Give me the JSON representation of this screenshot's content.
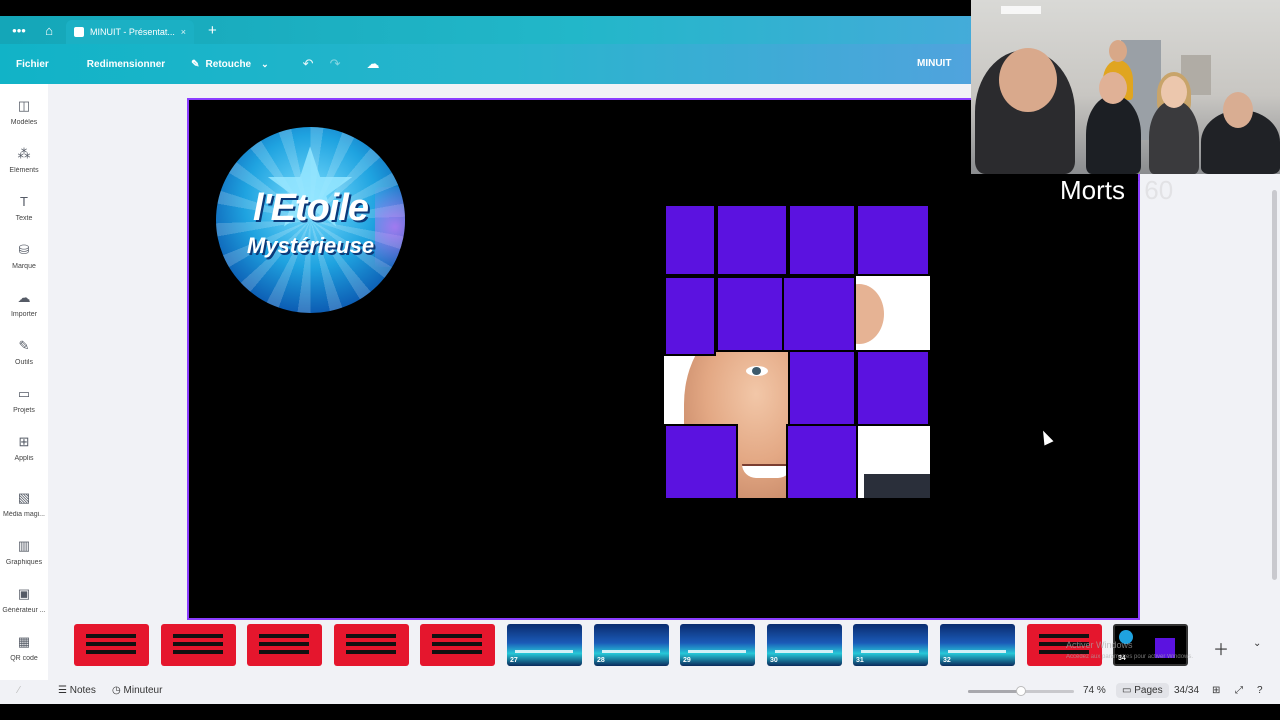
{
  "browser": {
    "tab_title": "MINUIT - Présentat...",
    "tab_close": "×",
    "new_tab": "+",
    "menu_glyph": "•••",
    "home_glyph": "⌂"
  },
  "toolbar": {
    "file_label": "Fichier",
    "resize_label": "Redimensionner",
    "retouch_label": "Retouche",
    "doc_name": "MINUIT"
  },
  "sidebar": {
    "items": [
      {
        "label": "Modèles"
      },
      {
        "label": "Éléments"
      },
      {
        "label": "Texte"
      },
      {
        "label": "Marque"
      },
      {
        "label": "Importer"
      },
      {
        "label": "Outils"
      },
      {
        "label": "Projets"
      },
      {
        "label": "Applis"
      },
      {
        "label": "Média magi..."
      },
      {
        "label": "Graphiques"
      },
      {
        "label": "Générateur ..."
      },
      {
        "label": "QR code"
      }
    ]
  },
  "slide": {
    "logo_line1": "l'Etoile",
    "logo_line2": "Mystérieuse"
  },
  "overlay": {
    "morts_label": "Morts",
    "morts_count": "60"
  },
  "filmstrip": {
    "pages": [
      {
        "num": "",
        "style": "red"
      },
      {
        "num": "",
        "style": "red"
      },
      {
        "num": "",
        "style": "red"
      },
      {
        "num": "",
        "style": "red"
      },
      {
        "num": "",
        "style": "red"
      },
      {
        "num": "27",
        "style": "blue"
      },
      {
        "num": "28",
        "style": "blue"
      },
      {
        "num": "29",
        "style": "blue"
      },
      {
        "num": "30",
        "style": "blue"
      },
      {
        "num": "31",
        "style": "blue"
      },
      {
        "num": "32",
        "style": "blue"
      },
      {
        "num": "",
        "style": "red"
      },
      {
        "num": "34",
        "style": "active"
      }
    ],
    "watermark_line1": "Activer Windows",
    "watermark_line2": "Accédez aux paramètres pour activer Windows."
  },
  "statusbar": {
    "notes_label": "Notes",
    "timer_label": "Minuteur",
    "zoom": "74 %",
    "zoom_level": 0.5,
    "pages_label": "Pages",
    "page_count": "34/34"
  },
  "colors": {
    "accent_purple": "#8b3dff",
    "tile_purple": "#5b12e0",
    "toolbar_start": "#11b3c7",
    "toolbar_end": "#6b97e8"
  }
}
